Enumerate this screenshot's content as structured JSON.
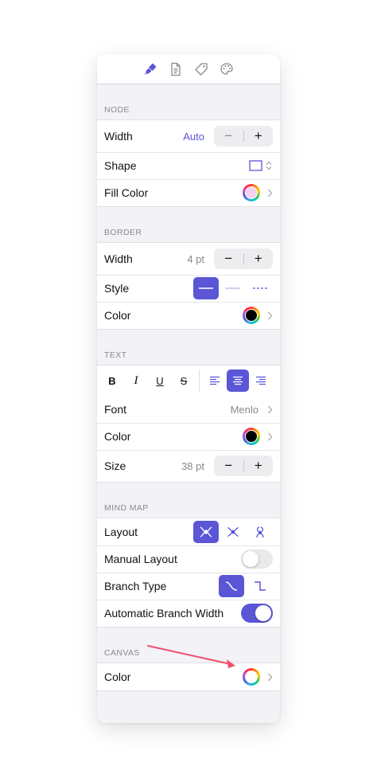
{
  "toolbar": {
    "tabs": [
      {
        "icon": "brush-icon",
        "active": true
      },
      {
        "icon": "document-icon",
        "active": false
      },
      {
        "icon": "tag-icon",
        "active": false
      },
      {
        "icon": "palette-icon",
        "active": false
      }
    ]
  },
  "node": {
    "header": "NODE",
    "width_label": "Width",
    "width_value": "Auto",
    "stepper_minus": "−",
    "stepper_plus": "+",
    "shape_label": "Shape",
    "fill_color_label": "Fill Color",
    "fill_color": "#f6d2ee"
  },
  "border": {
    "header": "BORDER",
    "width_label": "Width",
    "width_value": "4 pt",
    "stepper_minus": "−",
    "stepper_plus": "+",
    "style_label": "Style",
    "color_label": "Color",
    "color": "#000000"
  },
  "text": {
    "header": "TEXT",
    "bold": "B",
    "italic": "I",
    "underline": "U",
    "strike": "S",
    "font_label": "Font",
    "font_value": "Menlo",
    "color_label": "Color",
    "color": "#000000",
    "size_label": "Size",
    "size_value": "38 pt",
    "stepper_minus": "−",
    "stepper_plus": "+"
  },
  "mindmap": {
    "header": "MIND MAP",
    "layout_label": "Layout",
    "manual_layout_label": "Manual Layout",
    "manual_layout_on": false,
    "branch_type_label": "Branch Type",
    "auto_branch_width_label": "Automatic Branch Width",
    "auto_branch_width_on": true
  },
  "canvas": {
    "header": "CANVAS",
    "color_label": "Color",
    "color": "#ffffff"
  },
  "colors": {
    "accent": "#5a56d6",
    "annotation_arrow": "#f0506e"
  }
}
